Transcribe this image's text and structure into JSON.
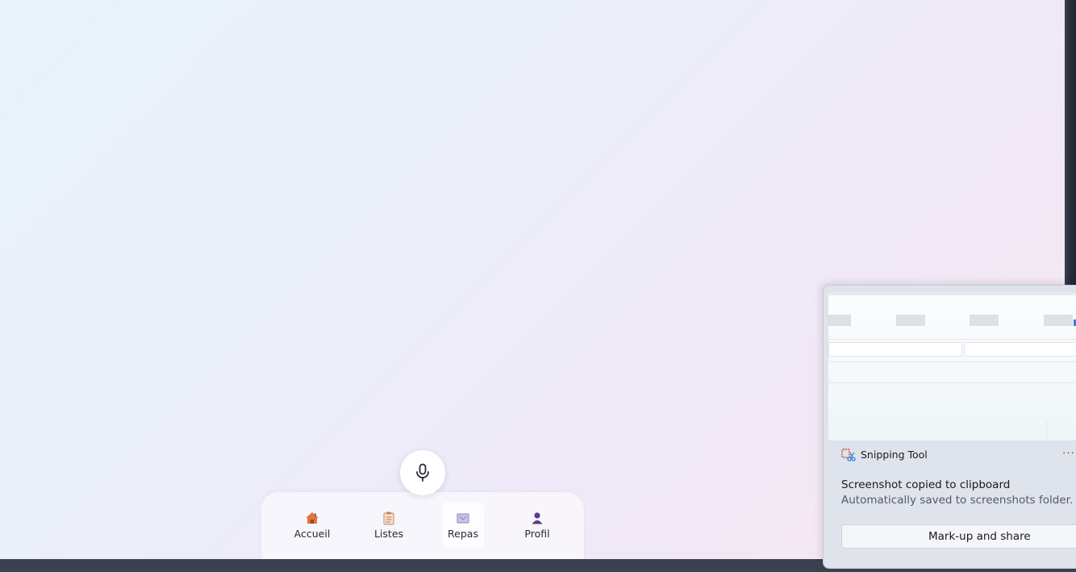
{
  "nav": {
    "items": [
      {
        "label": "Accueil",
        "icon": "house-icon"
      },
      {
        "label": "Listes",
        "icon": "clipboard-icon"
      },
      {
        "label": "Repas",
        "icon": "plate-icon"
      },
      {
        "label": "Profil",
        "icon": "person-icon"
      }
    ],
    "selected": "Repas"
  },
  "mic": {
    "icon": "microphone-icon"
  },
  "toast": {
    "app_name": "Snipping Tool",
    "more_label": "···",
    "title": "Screenshot copied to clipboard",
    "subtitle": "Automatically saved to screenshots folder.",
    "action_label": "Mark-up and share"
  },
  "colors": {
    "accent_purple": "#5b3a86",
    "house_orange": "#e2743a"
  }
}
